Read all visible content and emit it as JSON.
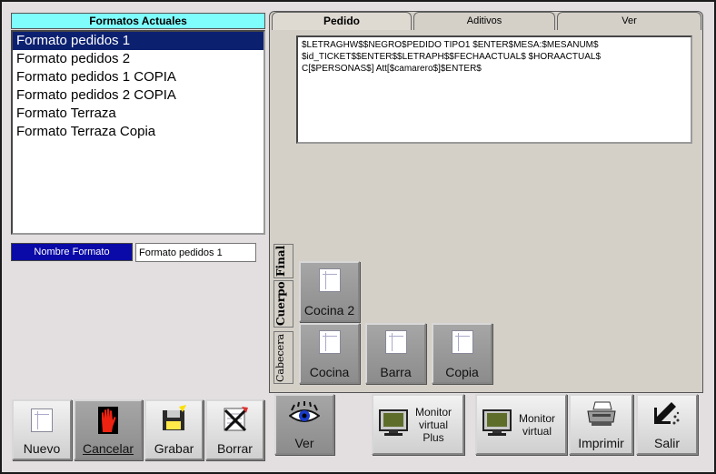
{
  "formats": {
    "title": "Formatos Actuales",
    "items": [
      "Formato pedidos 1",
      "Formato pedidos 2",
      "Formato pedidos 1 COPIA",
      "Formato pedidos 2 COPIA",
      "Formato Terraza",
      "Formato Terraza Copia"
    ],
    "selected_index": 0
  },
  "name_field": {
    "label": "Nombre Formato",
    "value": "Formato pedidos 1"
  },
  "left_buttons": {
    "nuevo": "Nuevo",
    "cancelar": "Cancelar",
    "grabar": "Grabar",
    "borrar": "Borrar"
  },
  "tabs": {
    "pedido": "Pedido",
    "aditivos": "Aditivos",
    "ver": "Ver"
  },
  "format_text": "$LETRAGHW$$NEGRO$PEDIDO TIPO1 $ENTER$MESA:$MESANUM$\n$id_TICKET$$ENTER$$LETRAPH$$FECHAACTUAL$ $HORAACTUAL$\nC[$PERSONAS$] Att[$camarero$]$ENTER$",
  "section_tabs": {
    "final": "Final",
    "cuerpo": "Cuerpo",
    "cabecera": "Cabecera"
  },
  "print_buttons": {
    "cocina2": "Cocina 2",
    "cocina": "Cocina",
    "barra": "Barra",
    "copia": "Copia"
  },
  "bottom_buttons": {
    "ver": "Ver",
    "monitor_plus_line1": "Monitor",
    "monitor_plus_line2": "virtual",
    "monitor_plus_line3": "Plus",
    "monitor_line1": "Monitor",
    "monitor_line2": "virtual",
    "imprimir": "Imprimir",
    "salir": "Salir"
  },
  "colors": {
    "list_title_bg": "#7ffcfc",
    "selected_row": "#0c2070",
    "name_label_bg": "#0a0aa8"
  },
  "icons": {
    "nuevo": "document-icon",
    "cancelar": "stop-hand-icon",
    "grabar": "floppy-disk-icon",
    "borrar": "delete-document-icon",
    "ver": "eye-icon",
    "monitor": "monitor-icon",
    "imprimir": "printer-icon",
    "salir": "exit-arrow-icon"
  }
}
